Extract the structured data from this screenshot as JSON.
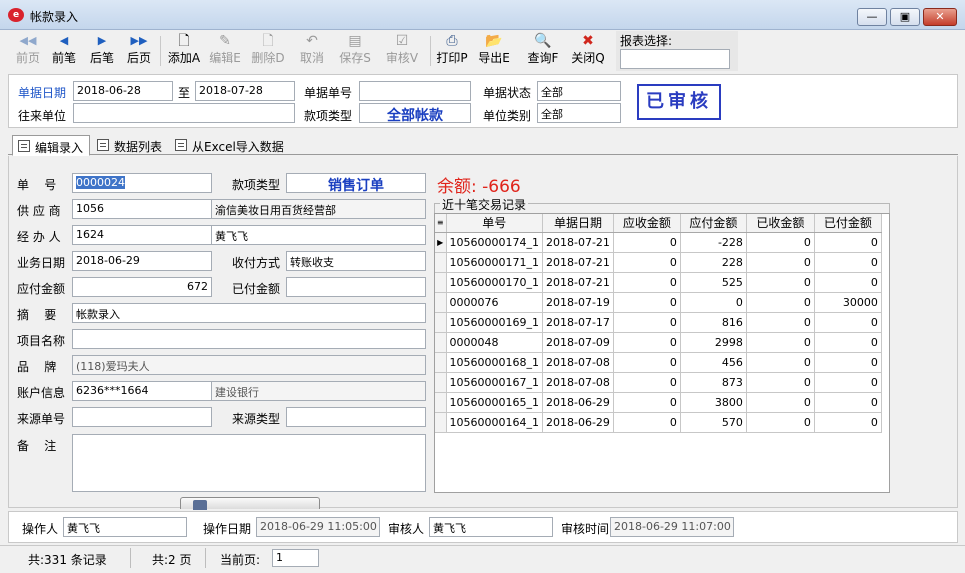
{
  "window": {
    "title": "帐款录入",
    "app_icon": "app-logo-icon"
  },
  "toolbar": {
    "buttons": [
      {
        "label": "前页",
        "icon": "first-page-icon",
        "enabled": false
      },
      {
        "label": "前笔",
        "icon": "prev-record-icon",
        "enabled": true
      },
      {
        "label": "后笔",
        "icon": "next-record-icon",
        "enabled": true
      },
      {
        "label": "后页",
        "icon": "last-page-icon",
        "enabled": true
      },
      {
        "label": "添加A",
        "icon": "add-icon",
        "enabled": true
      },
      {
        "label": "编辑E",
        "icon": "edit-icon",
        "enabled": false
      },
      {
        "label": "删除D",
        "icon": "delete-icon",
        "enabled": false
      },
      {
        "label": "取消",
        "icon": "undo-icon",
        "enabled": false
      },
      {
        "label": "保存S",
        "icon": "save-icon",
        "enabled": false
      },
      {
        "label": "审核V",
        "icon": "approve-icon",
        "enabled": false
      },
      {
        "label": "打印P",
        "icon": "print-icon",
        "enabled": true
      },
      {
        "label": "导出E",
        "icon": "export-icon",
        "enabled": true
      },
      {
        "label": "查询F",
        "icon": "query-icon",
        "enabled": true
      },
      {
        "label": "关闭Q",
        "icon": "close-x-icon",
        "enabled": true
      }
    ],
    "report_label": "报表选择:",
    "report_value": ""
  },
  "filter": {
    "date_label": "单据日期",
    "date_from": "2018-06-28",
    "to_label": "至",
    "date_to": "2018-07-28",
    "doc_no_label": "单据单号",
    "doc_no": "",
    "status_label": "单据状态",
    "status": "全部",
    "partner_label": "往来单位",
    "partner": "",
    "payment_type_label": "款项类型",
    "payment_type": "全部帐款",
    "unit_category_label": "单位类别",
    "unit_category": "全部",
    "stamp": "已审核"
  },
  "tabs": [
    {
      "label": "编辑录入",
      "active": true
    },
    {
      "label": "数据列表",
      "active": false
    },
    {
      "label": "从Excel导入数据",
      "active": false
    }
  ],
  "form": {
    "doc_no_label": "单    号",
    "doc_no": "0000024",
    "payment_type_label": "款项类型",
    "payment_type": "销售订单",
    "supplier_label": "供 应 商",
    "supplier_code": "1056",
    "supplier_name": "渝信美妆日用百货经营部",
    "handler_label": "经 办 人",
    "handler_code": "1624",
    "handler_name": "黄飞飞",
    "biz_date_label": "业务日期",
    "biz_date": "2018-06-29",
    "pay_method_label": "收付方式",
    "pay_method": "转账收支",
    "payable_label": "应付金额",
    "payable": "672",
    "paid_label": "已付金额",
    "paid": "",
    "summary_label": "摘    要",
    "summary": "帐款录入",
    "project_label": "项目名称",
    "project": "",
    "brand_label": "品    牌",
    "brand": "(118)爱玛夫人",
    "account_label": "账户信息",
    "account_no": "6236***1664",
    "bank": "建设银行",
    "source_no_label": "来源单号",
    "source_no": "",
    "source_type_label": "来源类型",
    "source_type": "",
    "remark_label": "备    注",
    "remark": ""
  },
  "balance": "余额: -666",
  "recent": {
    "caption": "近十笔交易记录",
    "columns": [
      "单号",
      "单据日期",
      "应收金额",
      "应付金额",
      "已收金额",
      "已付金额"
    ],
    "rows": [
      [
        "10560000174_1",
        "2018-07-21",
        "0",
        "-228",
        "0",
        "0"
      ],
      [
        "10560000171_1",
        "2018-07-21",
        "0",
        "228",
        "0",
        "0"
      ],
      [
        "10560000170_1",
        "2018-07-21",
        "0",
        "525",
        "0",
        "0"
      ],
      [
        "0000076",
        "2018-07-19",
        "0",
        "0",
        "0",
        "30000"
      ],
      [
        "10560000169_1",
        "2018-07-17",
        "0",
        "816",
        "0",
        "0"
      ],
      [
        "0000048",
        "2018-07-09",
        "0",
        "2998",
        "0",
        "0"
      ],
      [
        "10560000168_1",
        "2018-07-08",
        "0",
        "456",
        "0",
        "0"
      ],
      [
        "10560000167_1",
        "2018-07-08",
        "0",
        "873",
        "0",
        "0"
      ],
      [
        "10560000165_1",
        "2018-06-29",
        "0",
        "3800",
        "0",
        "0"
      ],
      [
        "10560000164_1",
        "2018-06-29",
        "0",
        "570",
        "0",
        "0"
      ]
    ]
  },
  "footer": {
    "operator_label": "操作人",
    "operator": "黄飞飞",
    "op_date_label": "操作日期",
    "op_date": "2018-06-29 11:05:00",
    "auditor_label": "审核人",
    "auditor": "黄飞飞",
    "audit_time_label": "审核时间",
    "audit_time": "2018-06-29 11:07:00"
  },
  "statusbar": {
    "total_records": "共:331 条记录",
    "total_pages": "共:2 页",
    "current_page_label": "当前页:",
    "current_page": "1"
  },
  "colors": {
    "accent_blue": "#1f56c8",
    "balance_red": "#e0241b",
    "stamp_blue": "#2a3cc0"
  }
}
